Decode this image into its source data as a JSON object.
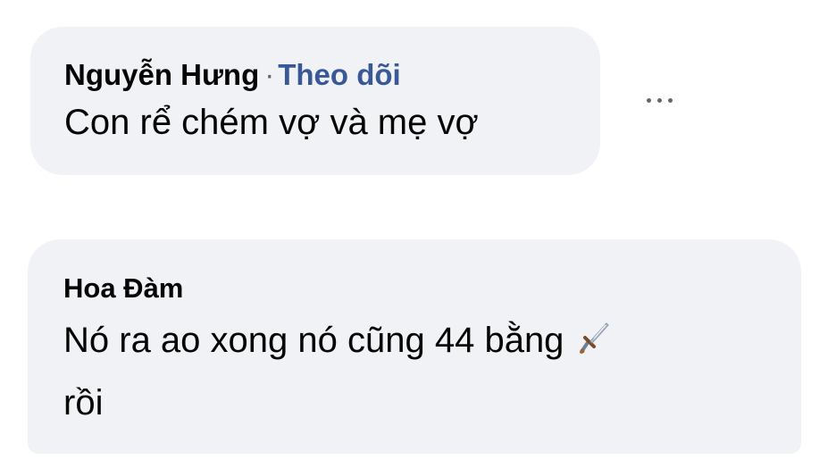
{
  "comments": [
    {
      "author": "Nguyễn Hưng",
      "separator": "·",
      "follow_label": "Theo dõi",
      "text": "Con rể chém vợ và mẹ vợ"
    },
    {
      "author": "Hoa Đàm",
      "text_line1": "Nó ra ao xong nó cũng 44 bằng",
      "text_line2": "rồi",
      "emoji_icon": "dagger-icon"
    }
  ],
  "more_icon": "more-options-icon",
  "colors": {
    "bubble_bg": "#f0f2f5",
    "link": "#385898",
    "text": "#050505",
    "secondary": "#65676b"
  }
}
